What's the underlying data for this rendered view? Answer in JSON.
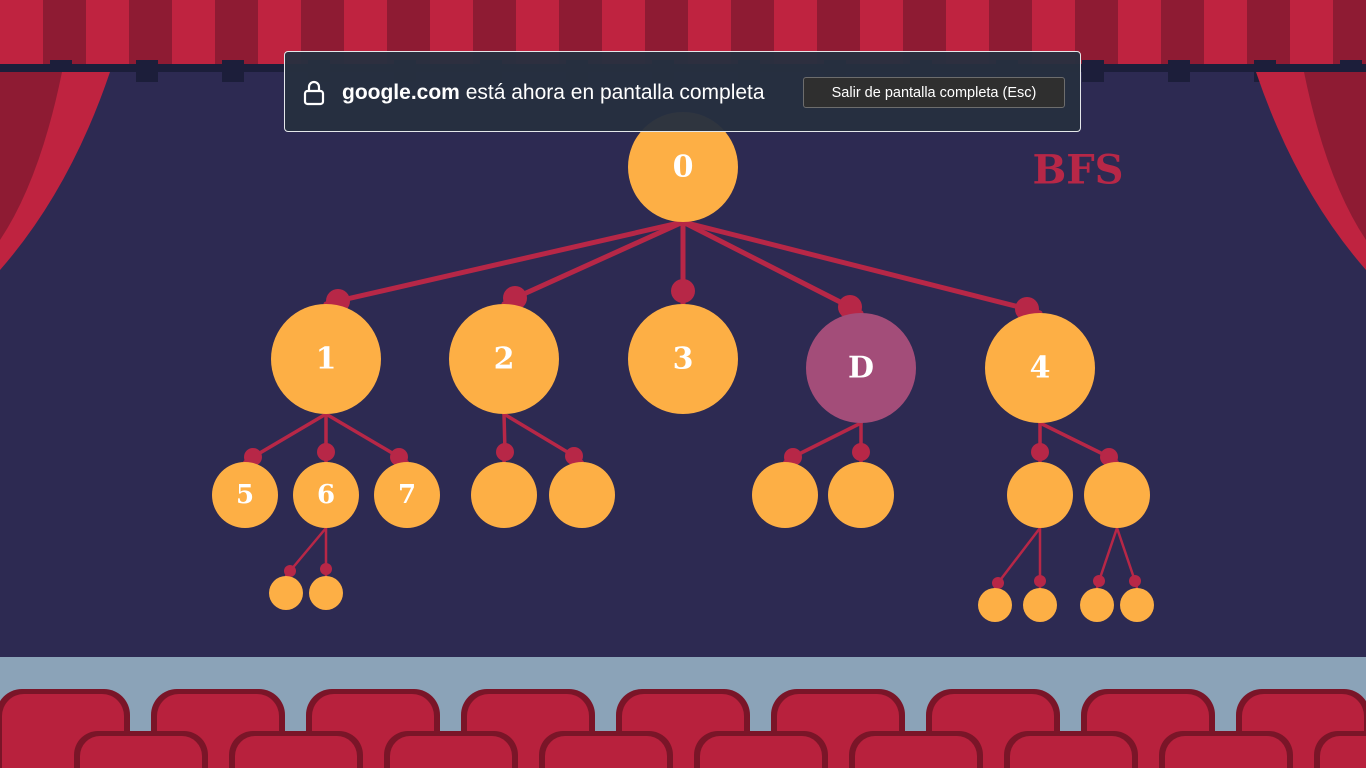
{
  "fullscreen_notice": {
    "domain": "google.com",
    "message": "está ahora en pantalla completa",
    "exit_button": "Salir de pantalla completa (Esc)",
    "icon": "lock-icon"
  },
  "slide": {
    "title": "BFS",
    "colors": {
      "background": "#2d2a52",
      "node": "#fdaf45",
      "highlight_node": "#a34d79",
      "edge": "#b72747",
      "curtain": "#bf2340",
      "curtain_dark": "#8e1b33",
      "floor": "#8ba3b8",
      "seat": "#b8213d"
    },
    "tree": {
      "root": "0",
      "level1": [
        "1",
        "2",
        "3",
        "D",
        "4"
      ],
      "level2": [
        "5",
        "6",
        "7",
        "",
        "",
        "",
        "",
        "",
        ""
      ],
      "level3": [
        "",
        "",
        "",
        "",
        "",
        ""
      ]
    }
  }
}
